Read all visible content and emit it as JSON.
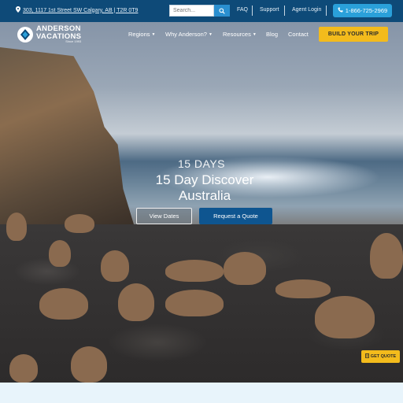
{
  "topbar": {
    "address": "303, 1117 1st Street SW Calgary, AB | T2R 0T9",
    "search_placeholder": "Search...",
    "links": [
      "FAQ",
      "Support",
      "Agent Login"
    ],
    "phone": "1-866-725-2969"
  },
  "logo": {
    "line1": "ANDERSON",
    "line2": "VACATIONS",
    "tagline": "Since 1993"
  },
  "nav": {
    "items": [
      {
        "label": "Regions",
        "dropdown": true
      },
      {
        "label": "Why Anderson?",
        "dropdown": true
      },
      {
        "label": "Resources",
        "dropdown": true
      },
      {
        "label": "Blog",
        "dropdown": false
      },
      {
        "label": "Contact",
        "dropdown": false
      }
    ],
    "cta": "BUILD YOUR TRIP"
  },
  "hero": {
    "eyebrow": "15 DAYS",
    "title": "15 Day Discover Australia",
    "btn_dates": "View Dates",
    "btn_quote": "Request a Quote"
  },
  "floating": {
    "get_quote": "GET QUOTE"
  },
  "colors": {
    "topbar": "#0e4a78",
    "accent": "#f3bb1c",
    "primary_button": "#0e5590",
    "phone_button": "#2aa0da"
  }
}
